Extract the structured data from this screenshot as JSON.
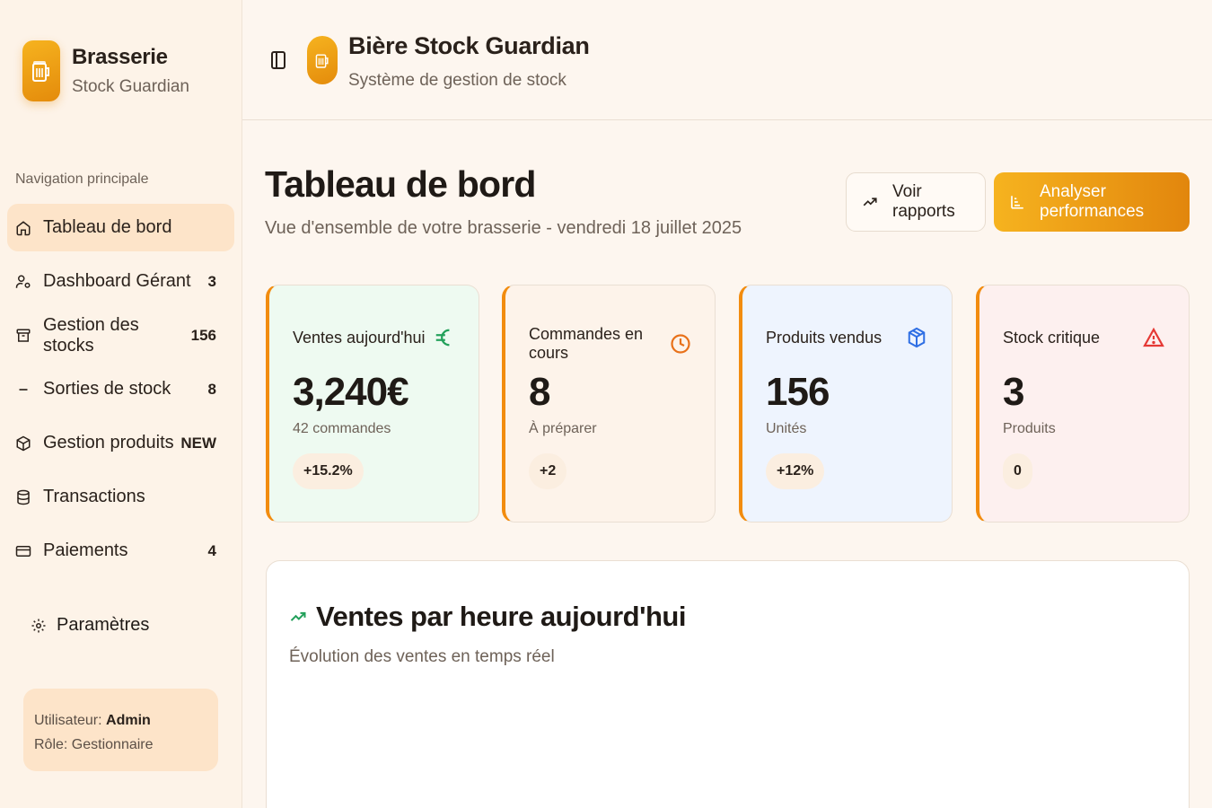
{
  "sidebar": {
    "brand_title": "Brasserie",
    "brand_subtitle": "Stock Guardian",
    "section_label": "Navigation principale",
    "items": [
      {
        "label": "Tableau de bord",
        "badge": "",
        "icon": "home-icon",
        "active": true
      },
      {
        "label": "Dashboard Gérant",
        "badge": "3",
        "icon": "user-cog-icon"
      },
      {
        "label": "Gestion des stocks",
        "badge": "156",
        "icon": "archive-icon"
      },
      {
        "label": "Sorties de stock",
        "badge": "8",
        "icon": "minus-icon"
      },
      {
        "label": "Gestion produits",
        "badge": "NEW",
        "icon": "package-icon"
      },
      {
        "label": "Transactions",
        "badge": "",
        "icon": "database-icon"
      },
      {
        "label": "Paiements",
        "badge": "4",
        "icon": "credit-card-icon"
      }
    ],
    "settings_label": "Paramètres",
    "user": {
      "user_prefix": "Utilisateur: ",
      "user_name": "Admin",
      "role_text": "Rôle: Gestionnaire"
    }
  },
  "header": {
    "title": "Bière Stock Guardian",
    "subtitle": "Système de gestion de stock"
  },
  "main": {
    "title": "Tableau de bord",
    "subtitle": "Vue d'ensemble de votre brasserie - vendredi 18 juillet 2025",
    "buttons": {
      "reports": "Voir rapports",
      "analyze": "Analyser performances"
    },
    "stats": [
      {
        "label": "Ventes aujourd'hui",
        "value": "3,240€",
        "sub": "42 commandes",
        "pill": "+15.2%",
        "icon": "euro-icon",
        "color": "#22a05a"
      },
      {
        "label": "Commandes en cours",
        "value": "8",
        "sub": "À préparer",
        "pill": "+2",
        "icon": "clock-icon",
        "color": "#e8711a"
      },
      {
        "label": "Produits vendus",
        "value": "156",
        "sub": "Unités",
        "pill": "+12%",
        "icon": "package-icon",
        "color": "#2f6fe4"
      },
      {
        "label": "Stock critique",
        "value": "3",
        "sub": "Produits",
        "pill": "0",
        "icon": "alert-triangle-icon",
        "color": "#e53935"
      }
    ],
    "chart_panel": {
      "title": "Ventes par heure aujourd'hui",
      "subtitle": "Évolution des ventes en temps réel"
    }
  },
  "colors": {
    "accent": "#f28c0f",
    "background": "#fdf6ef",
    "sidebar_active": "#fde4c9"
  }
}
